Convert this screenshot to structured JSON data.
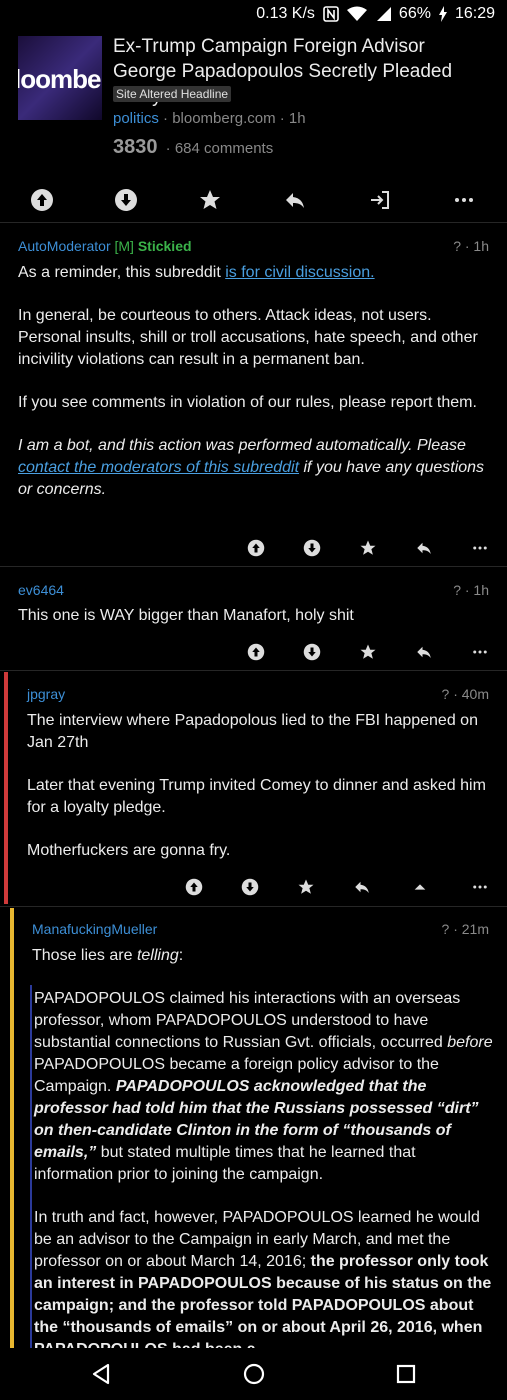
{
  "status_bar": {
    "speed": "0.13 K/s",
    "battery": "66%",
    "time": "16:29"
  },
  "post": {
    "thumbnail_text": "loomber",
    "title": "Ex-Trump Campaign Foreign Advisor George Papadopoulos Secretly Pleaded Guilty",
    "flair": "Site Altered Headline",
    "subreddit": "politics",
    "domain_age": " · bloomberg.com · 1h",
    "score": "3830",
    "comments": "· 684 comments"
  },
  "comments": [
    {
      "author": "AutoModerator",
      "mod_tag": "[M]",
      "stickied": "Stickied",
      "meta": "? · 1h",
      "p1_text": "As a reminder, this subreddit ",
      "p1_link": "is for civil discussion.",
      "p2": "In general, be courteous to others. Attack ideas, not users. Personal insults, shill or troll accusations, hate speech, and other incivility violations can result in a permanent ban.",
      "p3": "If you see comments in violation of our rules, please report them.",
      "p4_a": "I am a bot, and this action was performed automatically. Please ",
      "p4_link": "contact the moderators of this subreddit",
      "p4_b": " if you have any questions or concerns."
    },
    {
      "author": "ev6464",
      "meta": "? · 1h",
      "p1": "This one is WAY bigger than Manafort, holy shit"
    },
    {
      "author": "jpgray",
      "meta": "? · 40m",
      "p1": "The interview where Papadopolous lied to the FBI happened on Jan 27th",
      "p2": "Later that evening Trump invited Comey to dinner and asked him for a loyalty pledge.",
      "p3": "Motherfuckers are gonna fry."
    },
    {
      "author": "ManafuckingMueller",
      "meta": "? · 21m",
      "p1_a": "Those lies are ",
      "p1_em": "telling",
      "p1_b": ":",
      "q1_a": "PAPADOPOULOS claimed his interactions with an overseas professor, whom PAPADOPOULOS understood to have substantial connections to Russian Gvt. officials, occurred ",
      "q1_em": "before",
      "q1_b": " PAPADOPOULOS became a foreign policy advisor to the Campaign. ",
      "q1_bold": "PAPADOPOULOS acknowledged that the professor had told him that the Russians possessed “dirt” on then-candidate Clinton in the form of “thousands of emails,”",
      "q1_c": " but stated multiple times that he learned that information prior to joining the campaign.",
      "q2_a": "In truth and fact, however, PAPADOPOULOS learned he would be an advisor to the Campaign in early March, and met the professor on or about March 14, 2016; ",
      "q2_bold": "the professor only took an interest in PAPADOPOULOS because of his status on the campaign; and the professor told PAPADOPOULOS about the “thousands of emails” on or about April 26, 2016, when PAPADOPOULOS had been a"
    }
  ],
  "colors": {
    "link": "#3d8fd6",
    "mod": "#3bb34a",
    "thread_red": "#cf3a3a",
    "thread_yellow": "#e8b730"
  },
  "icons": [
    "upvote-icon",
    "downvote-icon",
    "star-icon",
    "reply-icon",
    "share-icon",
    "more-icon",
    "collapse-icon",
    "back-icon",
    "home-icon",
    "recents-icon"
  ]
}
